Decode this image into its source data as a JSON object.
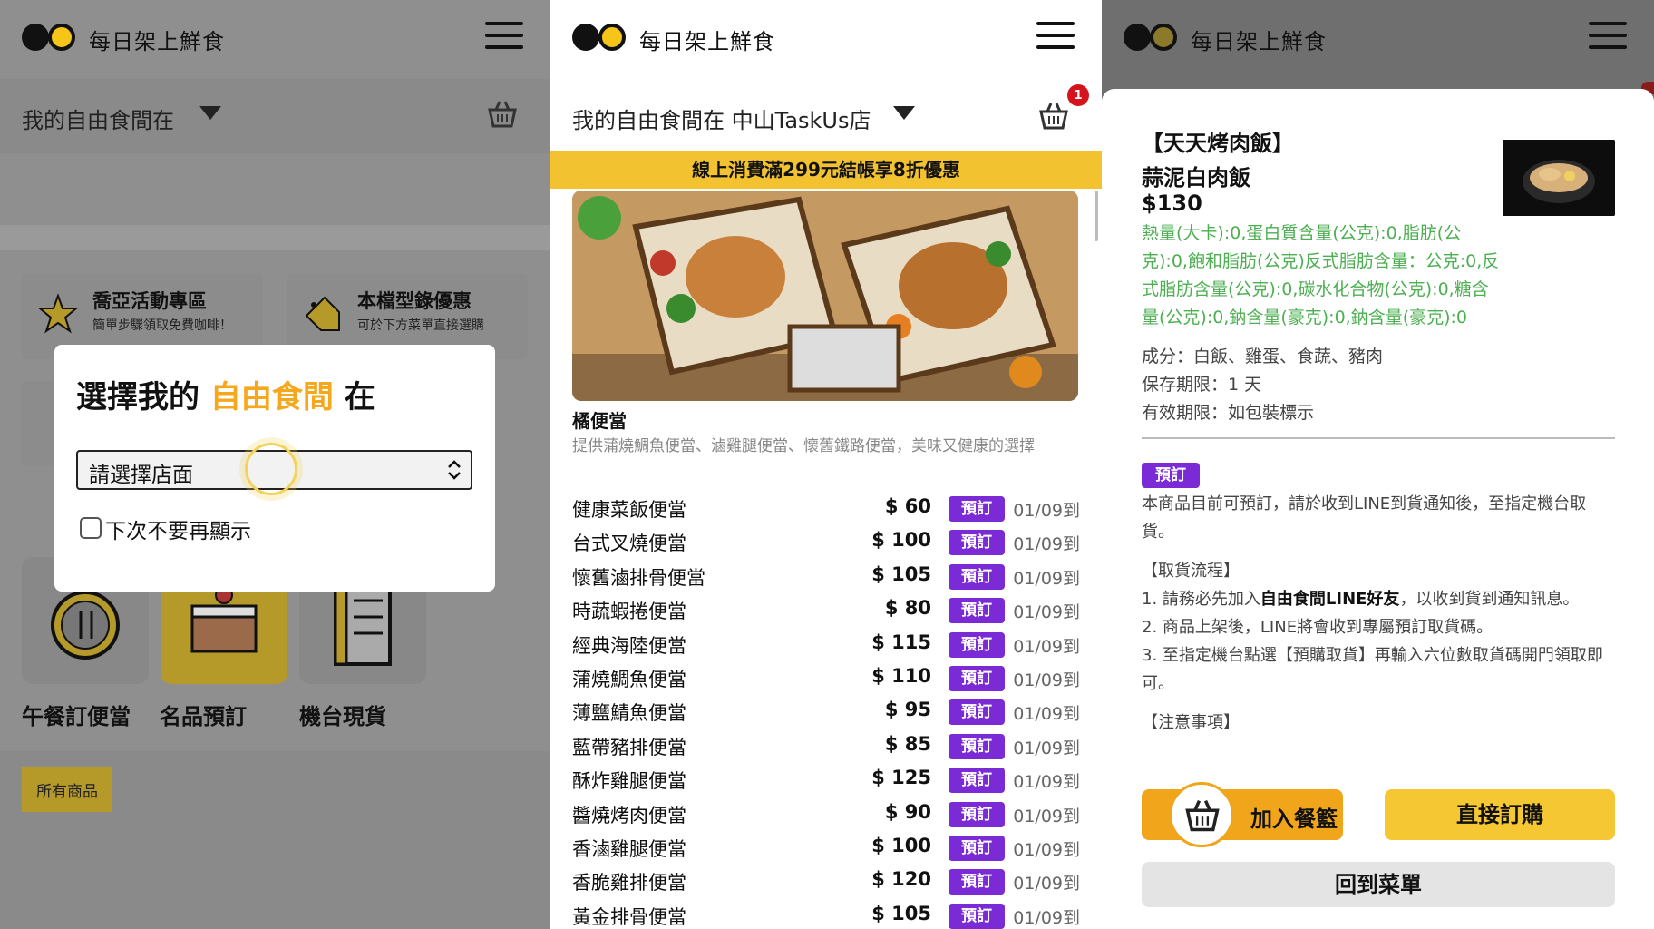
{
  "app": {
    "brand": "每日架上鮮食"
  },
  "screen1": {
    "store_label": "我的自由食間在",
    "promos": [
      {
        "title": "喬亞活動專區",
        "subtitle": "簡單步驟領取免費咖啡！"
      },
      {
        "title": "本檔型錄優惠",
        "subtitle": "可於下方菜單直接選購"
      }
    ],
    "tiles": [
      {
        "label": "午餐訂便當"
      },
      {
        "label": "名品預訂"
      },
      {
        "label": "機台現貨"
      }
    ],
    "all_products": "所有商品",
    "modal": {
      "title_pre": "選擇我的",
      "title_highlight": "自由食間",
      "title_post": "在",
      "select_value": "請選擇店面",
      "checkbox_label": "下次不要再顯示"
    }
  },
  "screen2": {
    "store_label": "我的自由食間在 中山TaskUs店",
    "cart_count": "1",
    "banner": "線上消費滿299元結帳享8折優惠",
    "category": "橘便當",
    "category_desc": "提供蒲燒鯛魚便當、滷雞腿便當、懷舊鐵路便當，美味又健康的選擇",
    "badge_label": "預訂",
    "items": [
      {
        "name": "健康菜飯便當",
        "price": "$ 60",
        "date": "01/09到"
      },
      {
        "name": "台式叉燒便當",
        "price": "$ 100",
        "date": "01/09到"
      },
      {
        "name": "懷舊滷排骨便當",
        "price": "$ 105",
        "date": "01/09到"
      },
      {
        "name": "時蔬蝦捲便當",
        "price": "$ 80",
        "date": "01/09到"
      },
      {
        "name": "經典海陸便當",
        "price": "$ 115",
        "date": "01/09到"
      },
      {
        "name": "蒲燒鯛魚便當",
        "price": "$ 110",
        "date": "01/09到"
      },
      {
        "name": "薄鹽鯖魚便當",
        "price": "$ 95",
        "date": "01/09到"
      },
      {
        "name": "藍帶豬排便當",
        "price": "$ 85",
        "date": "01/09到"
      },
      {
        "name": "酥炸雞腿便當",
        "price": "$ 125",
        "date": "01/09到"
      },
      {
        "name": "醬燒烤肉便當",
        "price": "$ 90",
        "date": "01/09到"
      },
      {
        "name": "香滷雞腿便當",
        "price": "$ 100",
        "date": "01/09到"
      },
      {
        "name": "香脆雞排便當",
        "price": "$ 120",
        "date": "01/09到"
      },
      {
        "name": "黃金排骨便當",
        "price": "$ 105",
        "date": "01/09到"
      }
    ]
  },
  "screen3": {
    "shop": "【天天烤肉飯】",
    "name": "蒜泥白肉飯",
    "price": "$130",
    "nutrition": "熱量(大卡):0,蛋白質含量(公克):0,脂肪(公克):0,飽和脂肪(公克)反式脂肪含量：公克:0,反式脂肪含量(公克):0,碳水化合物(公克):0,糖含量(公克):0,鈉含量(豪克):0,鈉含量(豪克):0",
    "ingredients": "成分：白飯、雞蛋、食蔬、豬肉",
    "shelf_life": "保存期限：1 天",
    "expiry": "有效期限：如包裝標示",
    "badge": "預訂",
    "preorder_note": "本商品目前可預訂，請於收到LINE到貨通知後，至指定機台取貨。",
    "flow_title": "【取貨流程】",
    "step1_pre": "1. 請務必先加入",
    "step1_bold": "自由食間LINE好友",
    "step1_post": "，以收到貨到通知訊息。",
    "step2": "2. 商品上架後，LINE將會收到專屬預訂取貨碼。",
    "step3": "3. 至指定機台點選【預購取貨】再輸入六位數取貨碼開門領取即可。",
    "notes_title": "【注意事項】",
    "btn_add": "加入餐籃",
    "btn_buy": "直接訂購",
    "btn_back": "回到菜單"
  }
}
